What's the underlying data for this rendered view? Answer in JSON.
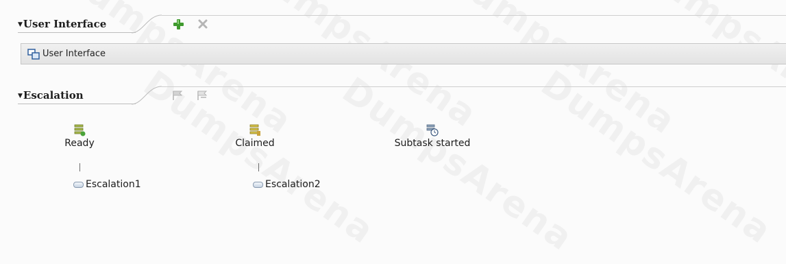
{
  "user_interface_section": {
    "title": "User Interface",
    "add_icon": "plus-icon",
    "remove_icon": "delete-icon",
    "row": {
      "label": "User Interface",
      "icon": "user-interface-icon"
    }
  },
  "escalation_section": {
    "title": "Escalation",
    "add_icon": "flag-add-icon",
    "remove_icon": "flag-remove-icon",
    "states": [
      {
        "label": "Ready",
        "icon": "ready-state-icon",
        "escalation": "Escalation1"
      },
      {
        "label": "Claimed",
        "icon": "claimed-state-icon",
        "escalation": "Escalation2"
      },
      {
        "label": "Subtask started",
        "icon": "subtask-started-icon",
        "escalation": ""
      }
    ]
  },
  "watermark": "DumpsArena",
  "colors": {
    "add_green": "#3f9a2e",
    "disabled_gray": "#b5b5b5",
    "row_border": "#c7c7c7"
  }
}
